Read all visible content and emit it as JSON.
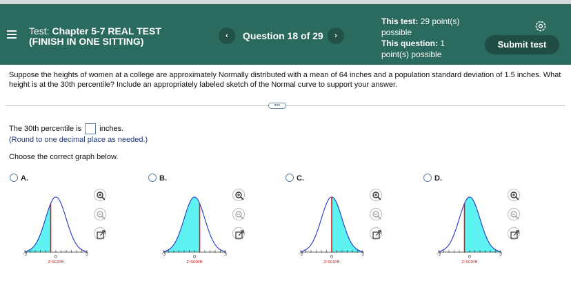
{
  "header": {
    "title_prefix": "Test:",
    "title_line1": "Chapter 5-7 REAL TEST",
    "title_line2": "(FINISH IN ONE SITTING)",
    "question_label": "Question 18 of 29",
    "prev_symbol": "‹",
    "next_symbol": "›",
    "points_this_test_label": "This test:",
    "points_this_test_value": "29 point(s)",
    "points_this_test_suffix": "possible",
    "points_this_question_label": "This question:",
    "points_this_question_value": "1",
    "points_this_question_suffix": "point(s) possible",
    "submit_label": "Submit test"
  },
  "question": {
    "text": "Suppose the heights of women at a college are approximately Normally distributed with a mean of 64 inches and a population standard deviation of 1.5 inches. What height is at the 30th percentile? Include an appropriately labeled sketch of the Normal curve to support your answer."
  },
  "more_button": "•••",
  "answer": {
    "prefix": "The 30th percentile is",
    "suffix": "inches.",
    "value": "",
    "round_note": "(Round to one decimal place as needed.)"
  },
  "choose_text": "Choose the correct graph below.",
  "options": [
    {
      "letter": "A.",
      "shade": "left",
      "cut_z": -0.5
    },
    {
      "letter": "B.",
      "shade": "left",
      "cut_z": 0.5
    },
    {
      "letter": "C.",
      "shade": "right",
      "cut_z": 0.0
    },
    {
      "letter": "D.",
      "shade": "right",
      "cut_z": -0.5
    }
  ],
  "graph_axis": {
    "min": -3,
    "max": 3,
    "label": "z-score",
    "tick_labels": [
      "-3",
      "0",
      "3"
    ]
  },
  "colors": {
    "header": "#2b6a5e",
    "submit": "#1f4d43",
    "shade": "#5ff2f2",
    "curve": "#2233cc",
    "cut": "#d62020",
    "axis_label": "#d62020"
  }
}
